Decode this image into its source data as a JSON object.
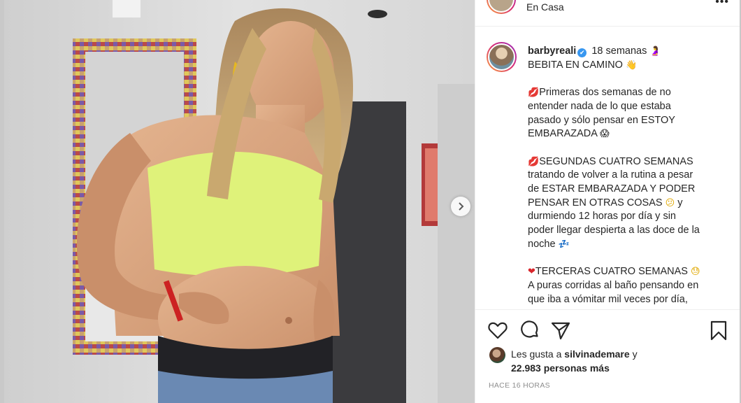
{
  "post": {
    "location": "En Casa",
    "more_label": "•••"
  },
  "caption": {
    "username": "barbyreali",
    "verified": "✔",
    "title_text": "18 semanas",
    "title_emoji": "🤰",
    "line2_text": "BEBITA EN CAMINO",
    "line2_emoji": "👋",
    "p1": [
      "Primeras dos semanas de no",
      "entender nada de lo que estaba",
      "pasado y sólo pensar en ESTOY",
      "EMBARAZADA"
    ],
    "p1_emoji": "😱",
    "p2": [
      "SEGUNDAS CUATRO SEMANAS",
      "tratando de volver a la rutina a pesar",
      "de ESTAR EMBARAZADA Y PODER",
      "PENSAR EN OTRAS COSAS",
      "durmiendo 12 horas por día y sin",
      "poder llegar despierta a las doce de la",
      "noche"
    ],
    "p2_y": "y",
    "p2_emoji_face": "😕",
    "p2_emoji_sleep": "💤",
    "p3": [
      "TERCERAS CUATRO SEMANAS",
      "A puras corridas al baño pensando en",
      "que iba a vómitar mil veces por día,"
    ],
    "p3_emoji": "😓",
    "bullet_emoji": "💋",
    "heart_emoji": "❤"
  },
  "likes": {
    "prefix": "Les gusta a",
    "liker": "silvinademare",
    "suffix": "y",
    "count": "22.983 personas más"
  },
  "timestamp": "HACE 16 HORAS",
  "icons": {
    "like": "heart-icon",
    "comment": "comment-icon",
    "share": "share-icon",
    "save": "bookmark-icon",
    "next": "chevron-right-icon"
  },
  "colors": {
    "verified": "#3897f0",
    "text": "#262626",
    "muted": "#8e8e8e",
    "divider": "#efefef"
  }
}
